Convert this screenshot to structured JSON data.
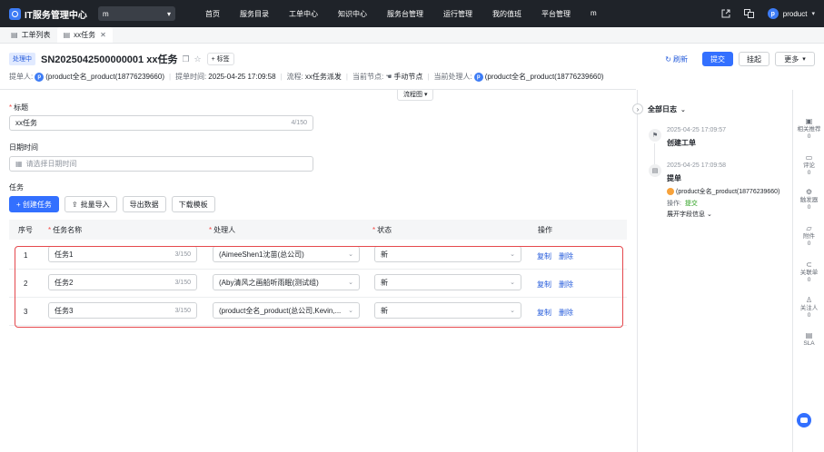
{
  "topbar": {
    "app_title": "IT服务管理中心",
    "workspace_value": "m",
    "nav_items": [
      "首页",
      "服务目录",
      "工单中心",
      "知识中心",
      "服务台管理",
      "运行管理",
      "我的值班",
      "平台管理",
      "m"
    ],
    "user_avatar": "p",
    "user_name": "product"
  },
  "tabs": [
    {
      "label": "工单列表"
    },
    {
      "label": "xx任务"
    }
  ],
  "ticket": {
    "status_badge": "处理中",
    "title": "SN2025042500000001 xx任务",
    "tag_button": "+ 标签",
    "refresh_label": "刷新",
    "submit_label": "提交",
    "hold_label": "挂起",
    "more_label": "更多"
  },
  "meta": {
    "submitter_label": "提单人:",
    "submitter_avatar": "p",
    "submitter_value": "(product全名_product(18776239660)",
    "submit_time_label": "提单时间:",
    "submit_time_value": "2025-04-25 17:09:58",
    "flow_label": "流程:",
    "flow_value": "xx任务派发",
    "node_label": "当前节点:",
    "node_value": "手动节点",
    "handler_label": "当前处理人:",
    "handler_avatar": "p",
    "handler_value": "(product全名_product(18776239660)"
  },
  "flowchart_toggle": "流程图",
  "form": {
    "title_label": "标题",
    "title_value": "xx任务",
    "title_count": "4/150",
    "date_label": "日期时间",
    "date_placeholder": "请选择日期时间",
    "task_label": "任务",
    "buttons": {
      "create": "+ 创建任务",
      "bulk_import": "批量导入",
      "export": "导出数据",
      "download_template": "下载模板"
    }
  },
  "table": {
    "headers": {
      "seq": "序号",
      "name": "任务名称",
      "handler": "处理人",
      "status": "状态",
      "ops": "操作"
    },
    "rows": [
      {
        "seq": "1",
        "name": "任务1",
        "count": "3/150",
        "handler": "(AimeeShen1沈苗(总公司)",
        "status": "新",
        "copy": "复制",
        "delete": "删除"
      },
      {
        "seq": "2",
        "name": "任务2",
        "count": "3/150",
        "handler": "(Aby清风之画船听雨眠(测试组)",
        "status": "新",
        "copy": "复制",
        "delete": "删除"
      },
      {
        "seq": "3",
        "name": "任务3",
        "count": "3/150",
        "handler": "(product全名_product(总公司,Kevin,...",
        "status": "新",
        "copy": "复制",
        "delete": "删除"
      }
    ]
  },
  "logs": {
    "title": "全部日志",
    "entries": [
      {
        "time": "2025-04-25 17:09:57",
        "action": "创建工单"
      },
      {
        "time": "2025-04-25 17:09:58",
        "action": "提单",
        "user": "(product全名_product(18776239660)",
        "op_label": "操作:",
        "op_value": "提交",
        "expand": "展开字段信息"
      }
    ]
  },
  "sidebar": [
    {
      "label": "相关推荐",
      "count": "0",
      "icon": "recommend-icon"
    },
    {
      "label": "评论",
      "count": "0",
      "icon": "comment-icon"
    },
    {
      "label": "触发器",
      "count": "0",
      "icon": "trigger-icon"
    },
    {
      "label": "附件",
      "count": "0",
      "icon": "attachment-icon"
    },
    {
      "label": "关联单",
      "count": "0",
      "icon": "link-icon"
    },
    {
      "label": "关注人",
      "count": "0",
      "icon": "user-icon"
    },
    {
      "label": "SLA",
      "count": "",
      "icon": "sla-icon"
    }
  ],
  "colors": {
    "primary": "#3370ff",
    "highlight": "#e5484d",
    "topbar": "#1f2329"
  }
}
